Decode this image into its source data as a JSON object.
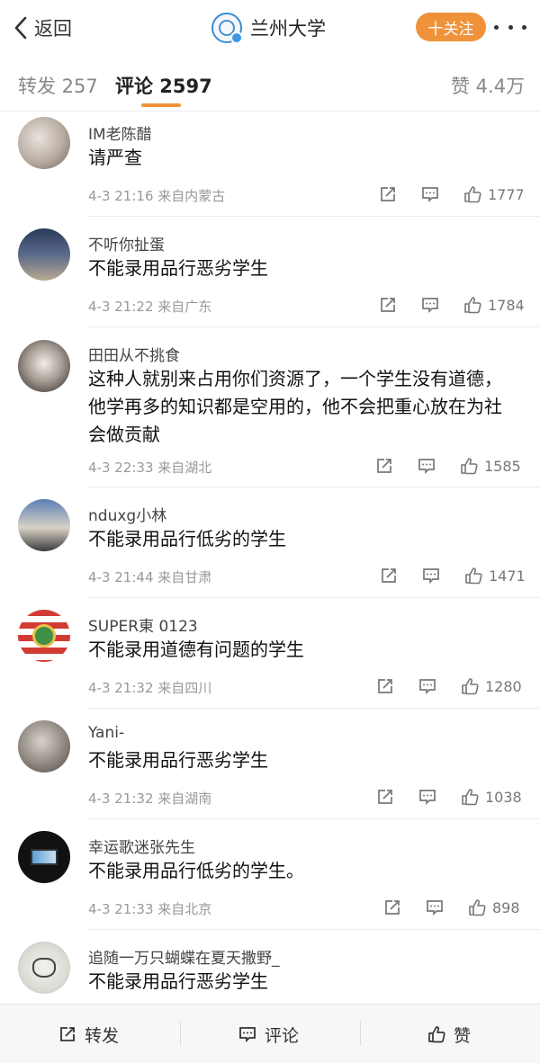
{
  "header": {
    "back_label": "返回",
    "title": "兰州大学",
    "follow_label": "十关注"
  },
  "tabs": {
    "repost": "转发 257",
    "comment": "评论 2597",
    "like": "赞 4.4万"
  },
  "comments": [
    {
      "name": "IM老陈醋",
      "text": "请严查",
      "time": "4-3 21:16",
      "location": "来自内蒙古",
      "likes": "1777"
    },
    {
      "name": "不听你扯蛋",
      "text": "不能录用品行恶劣学生",
      "time": "4-3 21:22",
      "location": "来自广东",
      "likes": "1784"
    },
    {
      "name": "田田从不挑食",
      "text": "这种人就别来占用你们资源了，一个学生没有道德，他学再多的知识都是空用的，他不会把重心放在为社会做贡献",
      "time": "4-3 22:33",
      "location": "来自湖北",
      "likes": "1585"
    },
    {
      "name": "nduxg小林",
      "text": "不能录用品行低劣的学生",
      "time": "4-3 21:44",
      "location": "来自甘肃",
      "likes": "1471"
    },
    {
      "name": "SUPER東 0123",
      "text": "不能录用道德有问题的学生",
      "time": "4-3 21:32",
      "location": "来自四川",
      "likes": "1280"
    },
    {
      "name": "Yani-",
      "text": "不能录用品行恶劣学生",
      "time": "4-3 21:32",
      "location": "来自湖南",
      "likes": "1038"
    },
    {
      "name": "幸运歌迷张先生",
      "text": "不能录用品行低劣的学生。",
      "time": "4-3 21:33",
      "location": "来自北京",
      "likes": "898"
    },
    {
      "name": "追随一万只蝴蝶在夏天撒野_",
      "text": "不能录用品行恶劣学生"
    }
  ],
  "bottom_bar": {
    "repost": "转发",
    "comment": "评论",
    "like": "赞"
  },
  "colors": {
    "accent": "#f0923a",
    "text_primary": "#111111",
    "text_secondary": "#999999"
  },
  "icons": [
    "back-arrow-icon",
    "verified-badge-icon",
    "more-dots-icon",
    "share-icon",
    "comment-icon",
    "like-icon"
  ]
}
